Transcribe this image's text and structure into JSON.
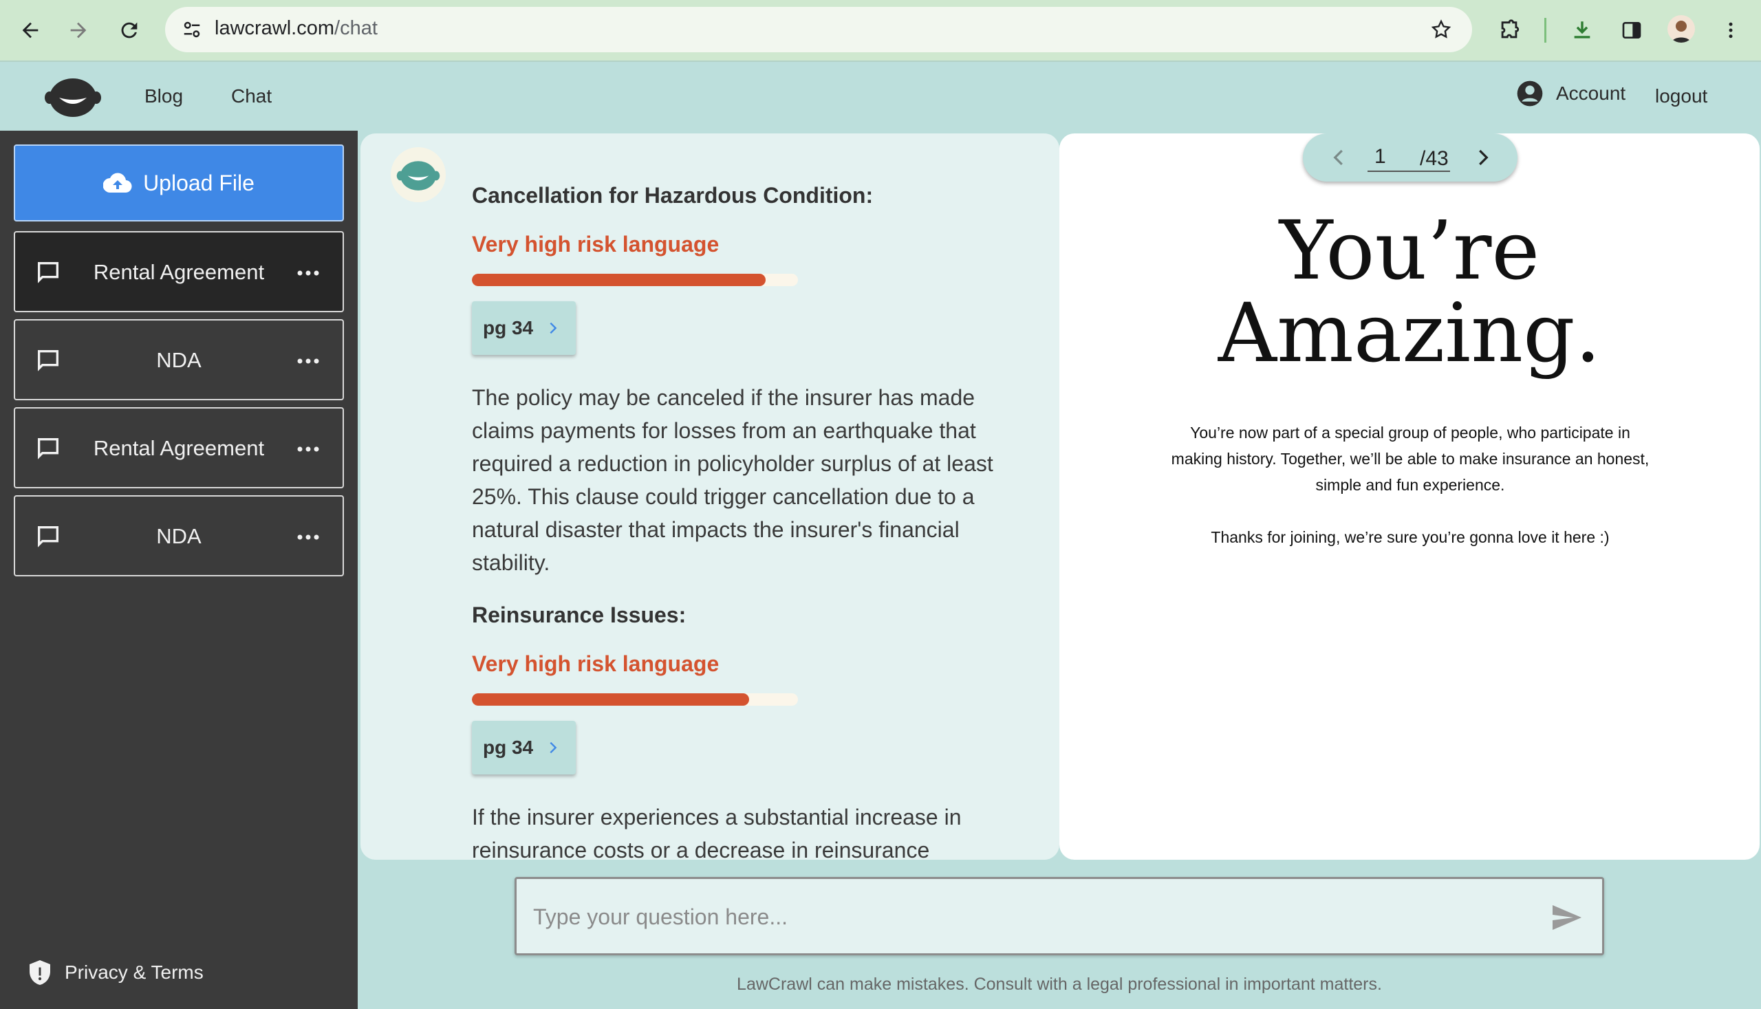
{
  "browser": {
    "url_domain": "lawcrawl.com",
    "url_path": "/chat"
  },
  "header": {
    "nav": [
      "Blog",
      "Chat"
    ],
    "account_label": "Account",
    "logout_label": "logout"
  },
  "sidebar": {
    "upload_label": "Upload File",
    "chats": [
      {
        "label": "Rental Agreement",
        "active": true
      },
      {
        "label": "NDA",
        "active": false
      },
      {
        "label": "Rental Agreement",
        "active": false
      },
      {
        "label": "NDA",
        "active": false
      }
    ],
    "privacy_label": "Privacy & Terms"
  },
  "chat": {
    "sections": [
      {
        "title": "Cancellation for Hazardous Condition:",
        "risk_label": "Very high risk language",
        "risk_level": 0.9,
        "page_ref": "pg 34",
        "body": "The policy may be canceled if the insurer has made claims payments for losses from an earthquake that required a reduction in policyholder surplus of at least 25%. This clause could trigger cancellation due to a natural disaster that impacts the insurer's financial stability."
      },
      {
        "title": "Reinsurance Issues:",
        "risk_label": "Very high risk language",
        "risk_level": 0.85,
        "page_ref": "pg 34",
        "body": "If the insurer experiences a substantial increase in reinsurance costs or a decrease in reinsurance availability, the"
      }
    ]
  },
  "doc": {
    "current_page": "1",
    "total_pages": "/43",
    "headline_line1": "You’re",
    "headline_line2": "Amazing.",
    "para1": "You’re now part of a special group of people, who participate in making history. Together, we’ll be able to make insurance an honest, simple and fun experience.",
    "para2": "Thanks for joining, we’re sure you’re gonna love it here :)"
  },
  "composer": {
    "placeholder": "Type your question here...",
    "disclaimer": "LawCrawl can make mistakes. Consult with a legal professional in important matters."
  },
  "colors": {
    "accent": "#3f88e6",
    "risk": "#d4532f",
    "mint": "#bcdfdc",
    "sidebar": "#3b3b3b"
  }
}
